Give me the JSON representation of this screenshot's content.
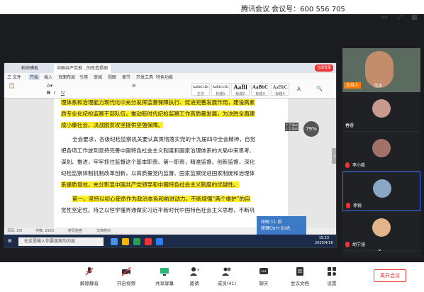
{
  "meeting": {
    "title": "腾讯会议 会议号：600 556 705",
    "buttons": [
      {
        "label": "解除静音",
        "icon": "mic-off-icon"
      },
      {
        "label": "开启视频",
        "icon": "video-off-icon"
      },
      {
        "label": "共享屏幕",
        "icon": "screen-share-icon"
      },
      {
        "label": "邀请",
        "icon": "invite-icon"
      },
      {
        "label": "成员(41)",
        "icon": "members-icon"
      },
      {
        "label": "聊天",
        "icon": "chat-icon"
      },
      {
        "label": "会议文档",
        "icon": "document-icon"
      },
      {
        "label": "设置",
        "icon": "settings-icon"
      }
    ],
    "leave_label": "离开会议",
    "accent": "#e23b3b"
  },
  "participants": [
    {
      "name": "沈沐",
      "badge": "主持人"
    },
    {
      "name": "春睿"
    },
    {
      "name": "李小毅"
    },
    {
      "name": "徐锐"
    },
    {
      "name": "胡宁涵"
    }
  ],
  "wps": {
    "tabs": [
      "稻壳模板",
      "中国共产党推…的改造提纲"
    ],
    "menus": [
      "三 文件",
      "开始",
      "插入",
      "页面布局",
      "引用",
      "审阅",
      "视图",
      "章节",
      "开发工具",
      "特色功能"
    ],
    "login_label": "立即登录",
    "styles": [
      {
        "sample": "AaBbCcDc",
        "name": "正文"
      },
      {
        "sample": "AaBbCcDc",
        "name": "标题1"
      },
      {
        "sample": "AaBl",
        "name": "标题2"
      },
      {
        "sample": "AaBbC",
        "name": "标题3"
      },
      {
        "sample": "AaBbC",
        "name": "标题4"
      }
    ],
    "lines": [
      {
        "text": "理体系和治理能力现代化中充分发挥监督保障执行、促进完善发展作用，建设高素",
        "highlight": true
      },
      {
        "text": "质专业化纪检监察干部队伍，推动新时代纪检监察工作高质量发展，为决胜全面建",
        "highlight": true
      },
      {
        "text": "成小康社会、决战脱贫攻坚提供坚强保障。",
        "highlight": true
      },
      {
        "text": "全会要求，各级纪检监察机关要认真贯彻落实党的十九届四中全会精神，自觉",
        "highlight": false
      },
      {
        "text": "把各项工作放到坚持完善中国特色社会主义制度和国家治理体系的大局中来思考、",
        "highlight": false
      },
      {
        "text": "谋划、推进，牢牢抓住监督这个基本职责、第一职责，精准监督、创新监督，深化",
        "highlight": false
      },
      {
        "text": "纪检监察体制机制改革创新，以高质量党内监督、国家监察促进国家制度和治理体",
        "highlight": "partial"
      },
      {
        "text": "系提质增效，充分彰显中国共产党领导和中国特色社会主义制度的优越性。",
        "highlight": true
      },
      {
        "text": "第一，坚持以初心使命作为政治本色和前进动力，不断增强“两个维护”的自",
        "highlight": true
      },
      {
        "text": "觉性坚定性。持之以恒学懂弄通做实习近平新时代中国特色社会主义思想，不断巩",
        "highlight": "partial"
      }
    ],
    "speed": "79%",
    "speed_up": "↑ 7.0k/s",
    "speed_down": "↓ 1.1k/s",
    "status": [
      "页码: 5/5",
      "字数: 2933",
      "拼写检查",
      "文档校对"
    ],
    "ime": "印刷 11 倍",
    "ime_sub": "按键Ctrl+Shift",
    "taskbar_search": "在这里输入你要搜索的内容",
    "time": "15:23",
    "date": "2020/4/16"
  }
}
